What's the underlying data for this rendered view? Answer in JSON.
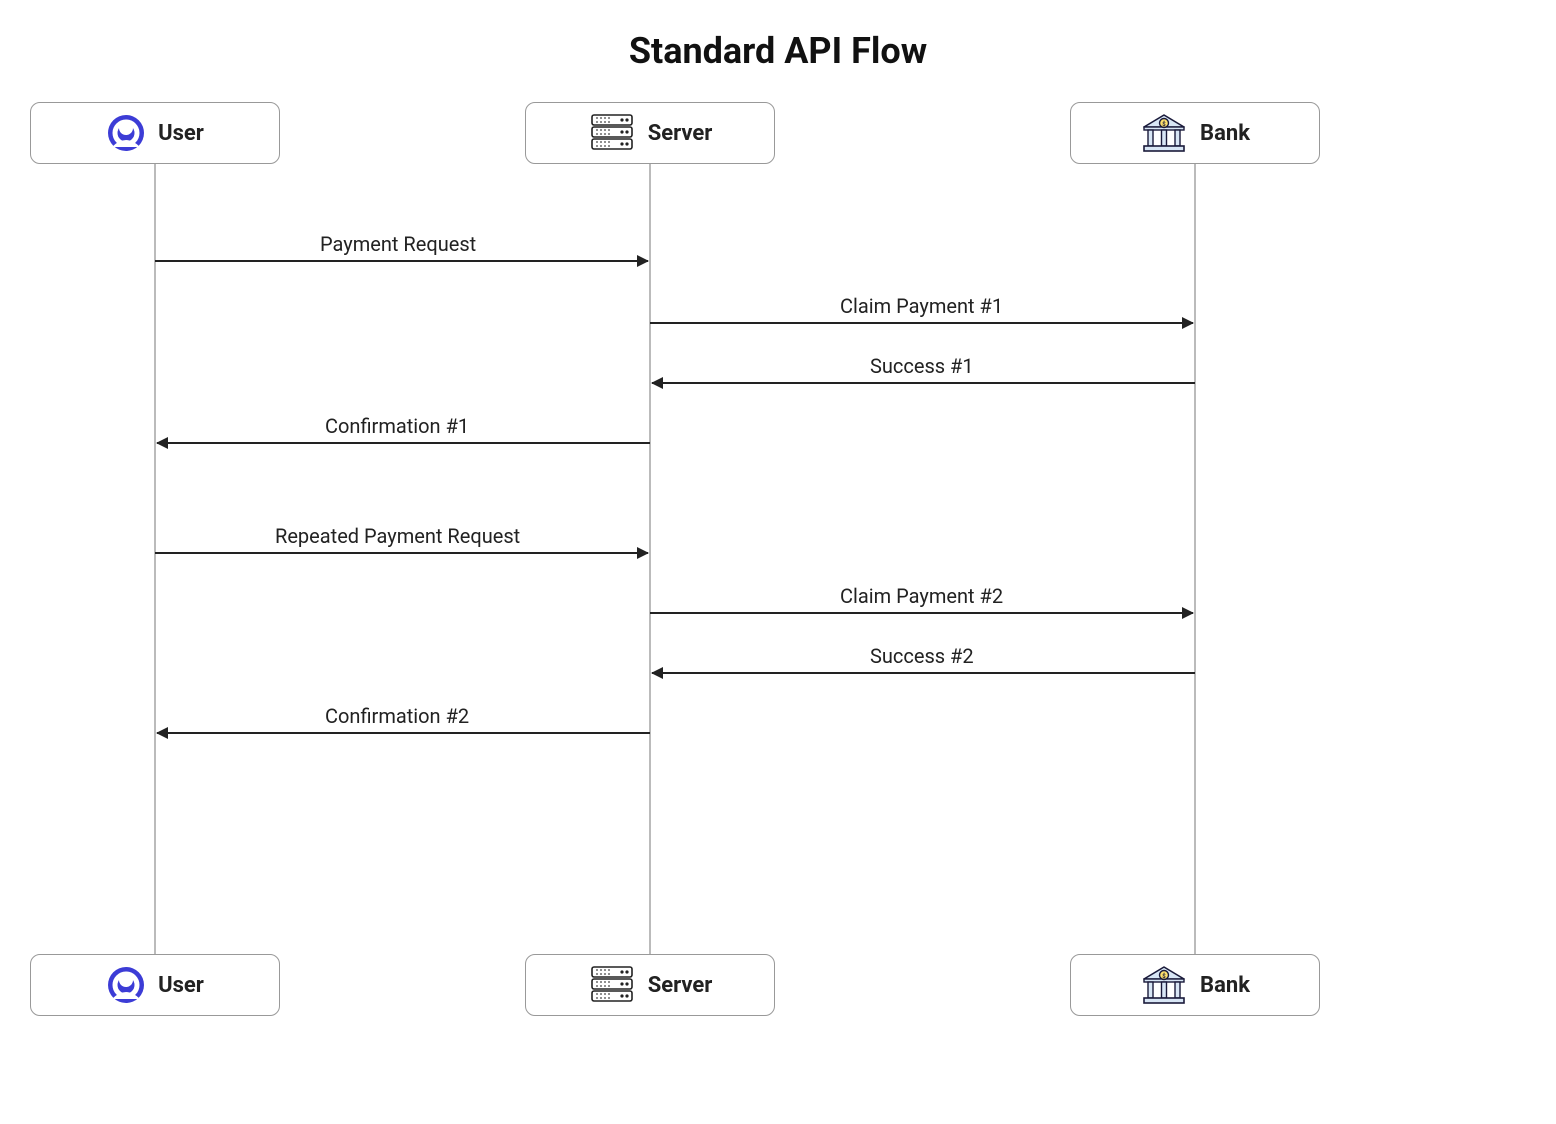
{
  "title": "Standard API Flow",
  "actors": {
    "user": {
      "label": "User",
      "icon": "user-icon"
    },
    "server": {
      "label": "Server",
      "icon": "server-icon"
    },
    "bank": {
      "label": "Bank",
      "icon": "bank-icon"
    }
  },
  "messages": {
    "m1": {
      "label": "Payment Request",
      "from": "user",
      "to": "server",
      "direction": "right"
    },
    "m2": {
      "label": "Claim Payment #1",
      "from": "server",
      "to": "bank",
      "direction": "right"
    },
    "m3": {
      "label": "Success #1",
      "from": "bank",
      "to": "server",
      "direction": "left"
    },
    "m4": {
      "label": "Confirmation #1",
      "from": "server",
      "to": "user",
      "direction": "left"
    },
    "m5": {
      "label": "Repeated Payment Request",
      "from": "user",
      "to": "server",
      "direction": "right"
    },
    "m6": {
      "label": "Claim Payment #2",
      "from": "server",
      "to": "bank",
      "direction": "right"
    },
    "m7": {
      "label": "Success #2",
      "from": "bank",
      "to": "server",
      "direction": "left"
    },
    "m8": {
      "label": "Confirmation #2",
      "from": "server",
      "to": "user",
      "direction": "left"
    }
  },
  "chart_data": {
    "type": "sequence-diagram",
    "title": "Standard API Flow",
    "participants": [
      "User",
      "Server",
      "Bank"
    ],
    "interactions": [
      {
        "from": "User",
        "to": "Server",
        "label": "Payment Request"
      },
      {
        "from": "Server",
        "to": "Bank",
        "label": "Claim Payment #1"
      },
      {
        "from": "Bank",
        "to": "Server",
        "label": "Success #1"
      },
      {
        "from": "Server",
        "to": "User",
        "label": "Confirmation #1"
      },
      {
        "from": "User",
        "to": "Server",
        "label": "Repeated Payment Request"
      },
      {
        "from": "Server",
        "to": "Bank",
        "label": "Claim Payment #2"
      },
      {
        "from": "Bank",
        "to": "Server",
        "label": "Success #2"
      },
      {
        "from": "Server",
        "to": "User",
        "label": "Confirmation #2"
      }
    ]
  }
}
